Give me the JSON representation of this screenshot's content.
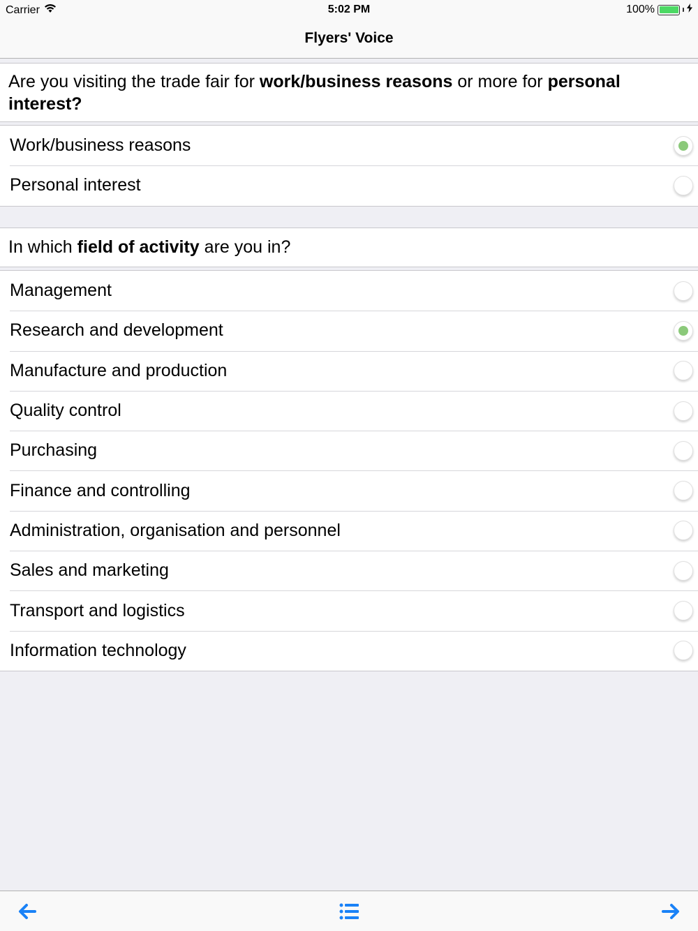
{
  "status_bar": {
    "carrier": "Carrier",
    "time": "5:02 PM",
    "battery_text": "100%",
    "battery_level": 1.0,
    "icons": [
      "wifi-icon",
      "battery-icon",
      "charging-icon"
    ]
  },
  "nav": {
    "title": "Flyers' Voice"
  },
  "question1": {
    "parts": [
      {
        "text": "Are you visiting the trade fair for ",
        "bold": false
      },
      {
        "text": "work/business reasons",
        "bold": true
      },
      {
        "text": " or more for ",
        "bold": false
      },
      {
        "text": "personal interest?",
        "bold": true
      }
    ],
    "options": [
      {
        "label": "Work/business reasons",
        "selected": true
      },
      {
        "label": "Personal interest",
        "selected": false
      }
    ]
  },
  "question2": {
    "parts": [
      {
        "text": "In which ",
        "bold": false
      },
      {
        "text": "field of activity",
        "bold": true
      },
      {
        "text": " are you in?",
        "bold": false
      }
    ],
    "options": [
      {
        "label": "Management",
        "selected": false
      },
      {
        "label": "Research and development",
        "selected": true
      },
      {
        "label": "Manufacture and production",
        "selected": false
      },
      {
        "label": "Quality control",
        "selected": false
      },
      {
        "label": "Purchasing",
        "selected": false
      },
      {
        "label": "Finance and controlling",
        "selected": false
      },
      {
        "label": "Administration, organisation and personnel",
        "selected": false
      },
      {
        "label": "Sales and marketing",
        "selected": false
      },
      {
        "label": "Transport and logistics",
        "selected": false
      },
      {
        "label": "Information technology",
        "selected": false
      }
    ]
  },
  "toolbar": {
    "icons": [
      "back-arrow-icon",
      "list-icon",
      "forward-arrow-icon"
    ],
    "accent": "#1a82f7"
  },
  "colors": {
    "selected_dot": "#8bc97a",
    "battery": "#4cd964",
    "background": "#efeff4"
  }
}
